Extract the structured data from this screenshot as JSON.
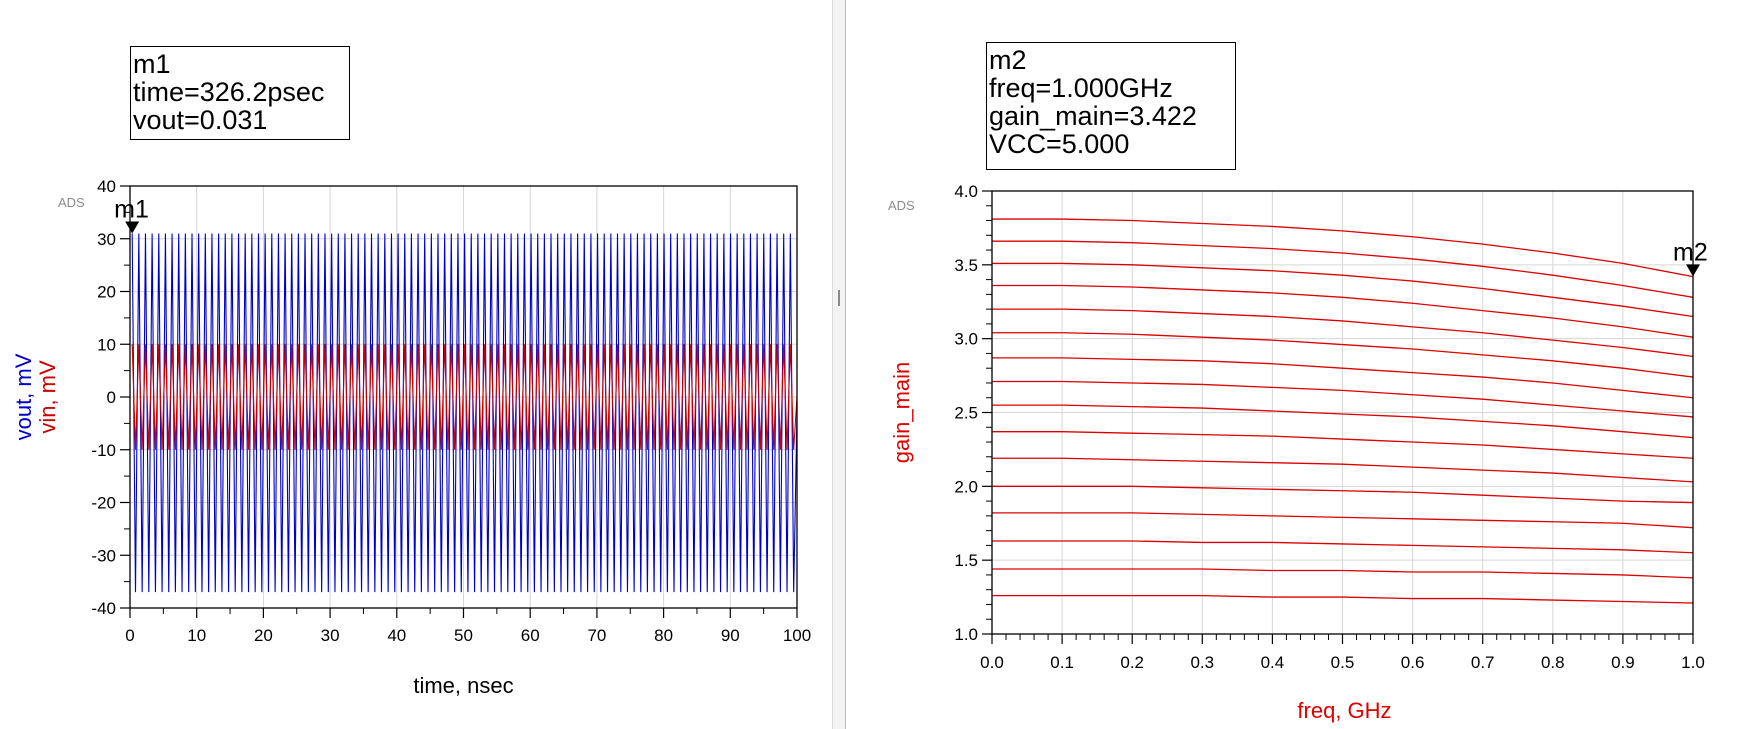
{
  "chart_data": [
    {
      "type": "line",
      "tag": "ADS",
      "xlabel": "time, nsec",
      "ylabel_parts": [
        {
          "text": "vout, mV",
          "color": "#0000cc"
        },
        {
          "text": "vin, mV",
          "color": "#cc0000"
        }
      ],
      "xlim": [
        0,
        100
      ],
      "ylim": [
        -40,
        40
      ],
      "x_ticks": [
        0,
        10,
        20,
        30,
        40,
        50,
        60,
        70,
        80,
        90,
        100
      ],
      "y_ticks": [
        -40,
        -30,
        -20,
        -10,
        0,
        10,
        20,
        30,
        40
      ],
      "x_minor": 2,
      "y_minor": 2,
      "grid": true,
      "series": [
        {
          "name": "vout",
          "color": "#0000cc",
          "cycles": 100,
          "max": 31,
          "min": -37
        },
        {
          "name": "vin",
          "color": "#cc0000",
          "cycles": 100,
          "max": 10,
          "min": -10
        }
      ],
      "marker": {
        "name": "m1",
        "lines": [
          "m1",
          "time=326.2psec",
          "vout=0.031"
        ],
        "x": 0.3262,
        "y": 31
      }
    },
    {
      "type": "line",
      "tag": "ADS",
      "xlabel": "freq, GHz",
      "ylabel": "gain_main",
      "axis_title_color": "#dd0000",
      "xlim": [
        0,
        1
      ],
      "ylim": [
        1,
        4
      ],
      "x_ticks": [
        0.0,
        0.1,
        0.2,
        0.3,
        0.4,
        0.5,
        0.6,
        0.7,
        0.8,
        0.9,
        1.0
      ],
      "x_tick_labels": [
        "0.0",
        "0.1",
        "0.2",
        "0.3",
        "0.4",
        "0.5",
        "0.6",
        "0.7",
        "0.8",
        "0.9",
        "1.0"
      ],
      "y_ticks": [
        1.0,
        1.5,
        2.0,
        2.5,
        3.0,
        3.5,
        4.0
      ],
      "y_tick_labels": [
        "1.0",
        "1.5",
        "2.0",
        "2.5",
        "3.0",
        "3.5",
        "4.0"
      ],
      "x_minor": 5,
      "y_minor": 5,
      "grid": true,
      "line_color": "#dd0000",
      "x": [
        0,
        0.1,
        0.2,
        0.3,
        0.4,
        0.5,
        0.6,
        0.7,
        0.8,
        0.9,
        1.0
      ],
      "series": [
        {
          "values": [
            3.81,
            3.81,
            3.8,
            3.78,
            3.76,
            3.73,
            3.69,
            3.64,
            3.58,
            3.51,
            3.42
          ]
        },
        {
          "values": [
            3.66,
            3.66,
            3.65,
            3.63,
            3.61,
            3.58,
            3.54,
            3.49,
            3.43,
            3.36,
            3.28
          ]
        },
        {
          "values": [
            3.51,
            3.51,
            3.5,
            3.48,
            3.46,
            3.43,
            3.39,
            3.34,
            3.28,
            3.22,
            3.15
          ]
        },
        {
          "values": [
            3.36,
            3.36,
            3.35,
            3.33,
            3.31,
            3.28,
            3.24,
            3.19,
            3.14,
            3.08,
            3.01
          ]
        },
        {
          "values": [
            3.2,
            3.2,
            3.19,
            3.17,
            3.15,
            3.12,
            3.08,
            3.04,
            2.99,
            2.94,
            2.88
          ]
        },
        {
          "values": [
            3.04,
            3.04,
            3.03,
            3.01,
            2.99,
            2.96,
            2.93,
            2.89,
            2.85,
            2.8,
            2.74
          ]
        },
        {
          "values": [
            2.87,
            2.87,
            2.86,
            2.85,
            2.83,
            2.8,
            2.77,
            2.74,
            2.7,
            2.65,
            2.6
          ]
        },
        {
          "values": [
            2.71,
            2.71,
            2.7,
            2.69,
            2.67,
            2.65,
            2.62,
            2.59,
            2.55,
            2.51,
            2.47
          ]
        },
        {
          "values": [
            2.55,
            2.55,
            2.54,
            2.53,
            2.51,
            2.49,
            2.47,
            2.44,
            2.41,
            2.37,
            2.33
          ]
        },
        {
          "values": [
            2.37,
            2.37,
            2.36,
            2.35,
            2.34,
            2.32,
            2.3,
            2.28,
            2.25,
            2.22,
            2.19
          ]
        },
        {
          "values": [
            2.19,
            2.19,
            2.18,
            2.17,
            2.16,
            2.15,
            2.13,
            2.11,
            2.09,
            2.06,
            2.03
          ]
        },
        {
          "values": [
            2.0,
            2.0,
            2.0,
            1.99,
            1.98,
            1.97,
            1.96,
            1.94,
            1.92,
            1.9,
            1.89
          ]
        },
        {
          "values": [
            1.82,
            1.82,
            1.82,
            1.81,
            1.8,
            1.79,
            1.78,
            1.77,
            1.76,
            1.75,
            1.72
          ]
        },
        {
          "values": [
            1.63,
            1.63,
            1.63,
            1.62,
            1.62,
            1.61,
            1.6,
            1.59,
            1.58,
            1.57,
            1.55
          ]
        },
        {
          "values": [
            1.44,
            1.44,
            1.44,
            1.44,
            1.43,
            1.43,
            1.42,
            1.42,
            1.41,
            1.4,
            1.38
          ]
        },
        {
          "values": [
            1.26,
            1.26,
            1.26,
            1.26,
            1.25,
            1.25,
            1.24,
            1.24,
            1.23,
            1.22,
            1.21
          ]
        }
      ],
      "marker": {
        "name": "m2",
        "lines": [
          "m2",
          "freq=1.000GHz",
          "gain_main=3.422",
          "VCC=5.000"
        ],
        "x": 1.0,
        "y": 3.422
      }
    }
  ]
}
